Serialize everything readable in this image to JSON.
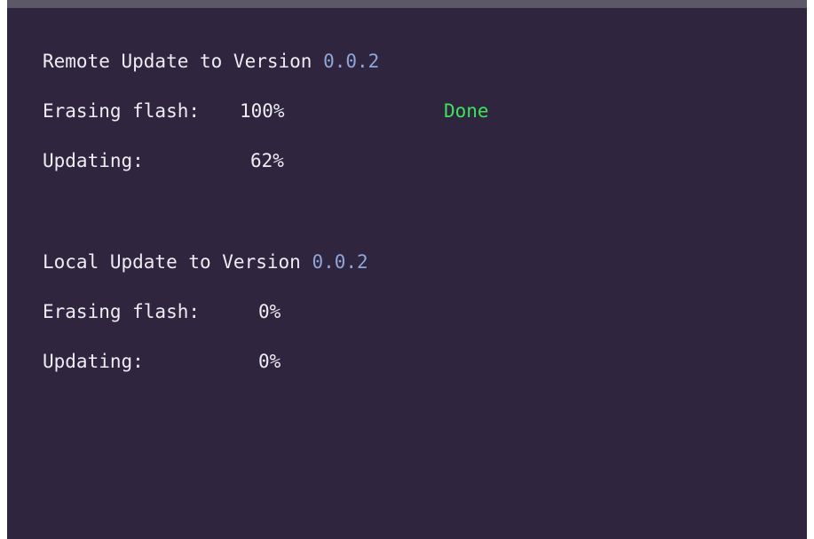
{
  "remote": {
    "title": "Remote Update to Version",
    "version": "0.0.2",
    "erasing_label": "Erasing flash:",
    "erasing_value": "100%",
    "erasing_status": "Done",
    "updating_label": "Updating:",
    "updating_value": "62%"
  },
  "local": {
    "title": "Local Update to Version",
    "version": "0.0.2",
    "erasing_label": "Erasing flash:",
    "erasing_value": "0%",
    "updating_label": "Updating:",
    "updating_value": "0%"
  },
  "colors": {
    "background": "#2f253f",
    "text": "#ededf2",
    "version": "#8fa6d8",
    "done": "#3ee35a",
    "top_bar": "#5c5868"
  }
}
